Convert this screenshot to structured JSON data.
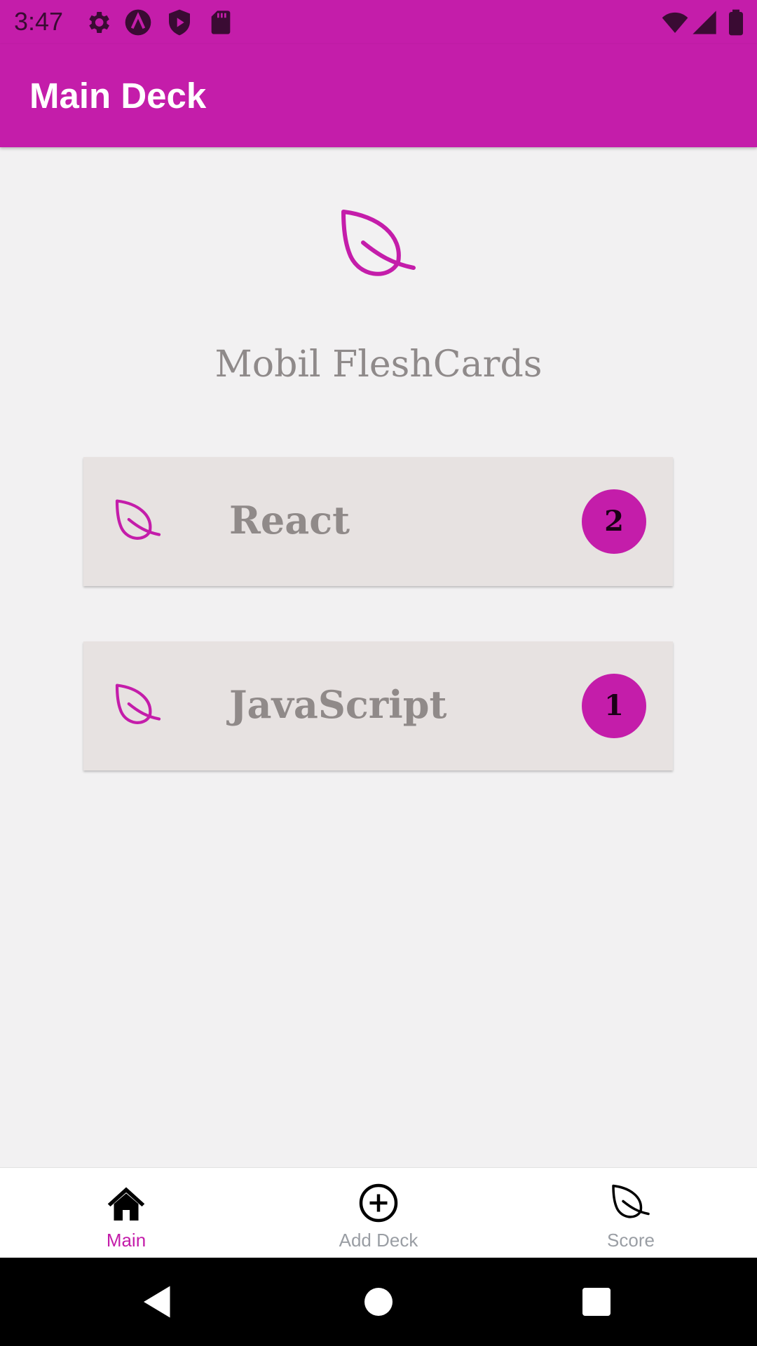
{
  "status_bar": {
    "time": "3:47",
    "left_icons": [
      "settings-icon",
      "app-a-icon",
      "play-protect-icon",
      "sd-card-icon"
    ],
    "right_icons": [
      "wifi-icon",
      "signal-icon",
      "battery-icon"
    ]
  },
  "app_bar": {
    "title": "Main Deck"
  },
  "hero": {
    "icon": "leaf-icon",
    "app_name": "Mobil FleshCards"
  },
  "decks": [
    {
      "name": "React",
      "count": "2",
      "icon": "leaf-icon"
    },
    {
      "name": "JavaScript",
      "count": "1",
      "icon": "leaf-icon"
    }
  ],
  "bottom_nav": {
    "items": [
      {
        "label": "Main",
        "icon": "home-icon",
        "active": true
      },
      {
        "label": "Add Deck",
        "icon": "add-circle-icon",
        "active": false
      },
      {
        "label": "Score",
        "icon": "leaf-icon",
        "active": false
      }
    ]
  },
  "system_nav": {
    "icons": [
      "back-icon",
      "home-circle-icon",
      "recents-icon"
    ]
  },
  "colors": {
    "primary": "#c41daa",
    "background": "#f2f1f2",
    "card": "#e7e2e1",
    "muted_text": "#908a89",
    "inactive_nav": "#9a9ea4"
  }
}
